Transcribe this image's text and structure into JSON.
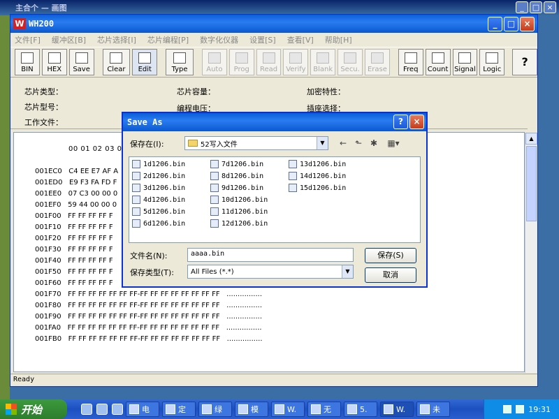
{
  "bg_window": {
    "title": "主合个 — 画图"
  },
  "app": {
    "title": "WH200",
    "logo": "W",
    "controls": [
      "_",
      "□",
      "×"
    ]
  },
  "menu": [
    "文件[F]",
    "缓冲区[B]",
    "芯片选择[I]",
    "芯片编程[P]",
    "数字化仪器",
    "设置[S]",
    "查看[V]",
    "帮助[H]"
  ],
  "toolbar": {
    "buttons": [
      {
        "label": "BIN",
        "icon": "open-bin-icon",
        "enabled": true
      },
      {
        "label": "HEX",
        "icon": "open-hex-icon",
        "enabled": true
      },
      {
        "label": "Save",
        "icon": "floppy-disk-icon",
        "enabled": true
      },
      {
        "label": "Clear",
        "icon": "blank-page-icon",
        "enabled": true
      },
      {
        "label": "Edit",
        "icon": "pencil-icon",
        "enabled": true,
        "selected": true
      },
      {
        "label": "Type",
        "icon": "chip-icon",
        "enabled": true
      },
      {
        "label": "Auto",
        "icon": "auto-icon",
        "enabled": false
      },
      {
        "label": "Prog",
        "icon": "program-icon",
        "enabled": false
      },
      {
        "label": "Read",
        "icon": "read-icon",
        "enabled": false
      },
      {
        "label": "Verify",
        "icon": "verify-icon",
        "enabled": false
      },
      {
        "label": "Blank",
        "icon": "blank-check-icon",
        "enabled": false
      },
      {
        "label": "Secu.",
        "icon": "lock-icon",
        "enabled": false
      },
      {
        "label": "Erase",
        "icon": "eraser-icon",
        "enabled": false
      },
      {
        "label": "Freq",
        "icon": "frequency-icon",
        "enabled": true
      },
      {
        "label": "Count",
        "icon": "counter-icon",
        "enabled": true
      },
      {
        "label": "Signal",
        "icon": "signal-icon",
        "enabled": true
      },
      {
        "label": "Logic",
        "icon": "logic-icon",
        "enabled": true
      }
    ],
    "help": "?"
  },
  "info": {
    "chip_type": "芯片类型：",
    "chip_capacity": "芯片容量：",
    "encryption": "加密特性：",
    "chip_model": "芯片型号：",
    "prog_voltage": "编程电压：",
    "socket": "插座选择：",
    "work_file": "工作文件："
  },
  "hex": {
    "header": "00 01 02 03 0",
    "rows": [
      {
        "addr": "001EC0",
        "data": "C4 EE E7 AF A"
      },
      {
        "addr": "001ED0",
        "data": "E9 F3 FA FD F"
      },
      {
        "addr": "001EE0",
        "data": "07 C3 00 00 0"
      },
      {
        "addr": "001EF0",
        "data": "59 44 00 00 0"
      },
      {
        "addr": "001F00",
        "data": "FF FF FF FF F"
      },
      {
        "addr": "001F10",
        "data": "FF FF FF FF F"
      },
      {
        "addr": "001F20",
        "data": "FF FF FF FF F"
      },
      {
        "addr": "001F30",
        "data": "FF FF FF FF F"
      },
      {
        "addr": "001F40",
        "data": "FF FF FF FF F"
      },
      {
        "addr": "001F50",
        "data": "FF FF FF FF F"
      },
      {
        "addr": "001F60",
        "data": "FF FF FF FF F"
      },
      {
        "addr": "001F70",
        "data": "FF FF FF FF FF FF FF-FF FF FF FF FF FF FF FF   ................"
      },
      {
        "addr": "001F80",
        "data": "FF FF FF FF FF FF FF-FF FF FF FF FF FF FF FF   ................"
      },
      {
        "addr": "001F90",
        "data": "FF FF FF FF FF FF FF-FF FF FF FF FF FF FF FF   ................"
      },
      {
        "addr": "001FA0",
        "data": "FF FF FF FF FF FF FF-FF FF FF FF FF FF FF FF   ................"
      },
      {
        "addr": "001FB0",
        "data": "FF FF FF FF FF FF FF-FF FF FF FF FF FF FF FF   ................"
      }
    ]
  },
  "status": "Ready",
  "dialog": {
    "title": "Save As",
    "help": "?",
    "close": "×",
    "save_in_label": "保存在(I):",
    "save_in_value": "52写入文件",
    "files": [
      "1d1206.bin",
      "2d1206.bin",
      "3d1206.bin",
      "4d1206.bin",
      "5d1206.bin",
      "6d1206.bin",
      "7d1206.bin",
      "8d1206.bin",
      "9d1206.bin",
      "10d1206.bin",
      "11d1206.bin",
      "12d1206.bin",
      "13d1206.bin",
      "14d1206.bin",
      "15d1206.bin"
    ],
    "filename_label": "文件名(N):",
    "filename_value": "aaaa.bin",
    "filetype_label": "保存类型(T):",
    "filetype_value": "All Files (*.*)",
    "save_button": "保存(S)",
    "cancel_button": "取消"
  },
  "taskbar": {
    "start": "开始",
    "tasks": [
      "电",
      "定",
      "绿",
      "模",
      "W.",
      "无",
      "5.",
      "W.",
      "未"
    ],
    "clock": "19:31"
  }
}
